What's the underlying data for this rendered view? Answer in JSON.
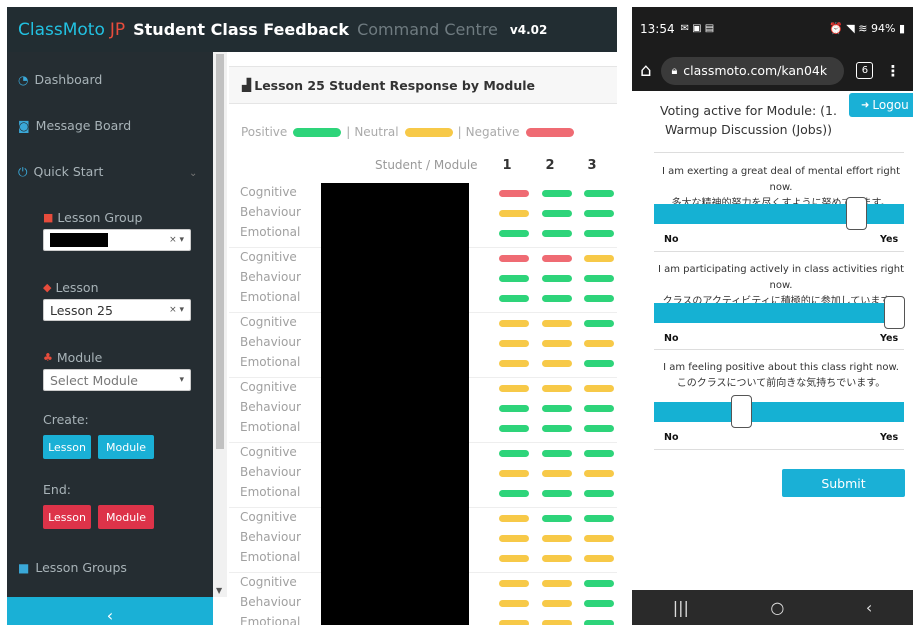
{
  "header": {
    "brand_main": "ClassMoto",
    "brand_suffix": "JP",
    "title": "Student Class Feedback",
    "subtitle": "Command Centre",
    "version": "v4.02"
  },
  "sidebar": {
    "dashboard": "Dashboard",
    "message_board": "Message Board",
    "quick_start": "Quick Start",
    "lesson_group_label": "Lesson Group",
    "lesson_label": "Lesson",
    "lesson_value": "Lesson 25",
    "module_label": "Module",
    "module_placeholder": "Select Module",
    "create_label": "Create:",
    "end_label": "End:",
    "btn_lesson": "Lesson",
    "btn_module": "Module",
    "lesson_groups": "Lesson Groups",
    "collapse_icon": "‹"
  },
  "panel": {
    "title": "Lesson 25 Student Response by Module",
    "legend": {
      "positive": "Positive",
      "neutral": "Neutral",
      "negative": "Negative",
      "sep": "|"
    },
    "column_header": "Student / Module",
    "modules": [
      "1",
      "2",
      "3"
    ],
    "categories": [
      "Cognitive",
      "Behaviour",
      "Emotional"
    ],
    "colors": {
      "positive": "#2ed47a",
      "neutral": "#f7c948",
      "negative": "#ef6b73"
    },
    "groups": [
      [
        [
          "neg",
          "pos",
          "pos"
        ],
        [
          "neu",
          "pos",
          "pos"
        ],
        [
          "pos",
          "pos",
          "pos"
        ]
      ],
      [
        [
          "neg",
          "neg",
          "neu"
        ],
        [
          "pos",
          "pos",
          "pos"
        ],
        [
          "pos",
          "pos",
          "pos"
        ]
      ],
      [
        [
          "neu",
          "neu",
          "pos"
        ],
        [
          "neu",
          "neu",
          "neu"
        ],
        [
          "neu",
          "neu",
          "pos"
        ]
      ],
      [
        [
          "neu",
          "neu",
          "neu"
        ],
        [
          "pos",
          "pos",
          "pos"
        ],
        [
          "pos",
          "pos",
          "pos"
        ]
      ],
      [
        [
          "pos",
          "pos",
          "pos"
        ],
        [
          "neu",
          "neu",
          "neu"
        ],
        [
          "pos",
          "pos",
          "pos"
        ]
      ],
      [
        [
          "neu",
          "pos",
          "pos"
        ],
        [
          "neu",
          "neu",
          "neu"
        ],
        [
          "neu",
          "neu",
          "neu"
        ]
      ],
      [
        [
          "neu",
          "neu",
          "pos"
        ],
        [
          "neu",
          "neu",
          "pos"
        ],
        [
          "neu",
          "neu",
          "pos"
        ]
      ]
    ]
  },
  "phone": {
    "status_time": "13:54",
    "status_right": "94%",
    "url": "classmoto.com/kan04k",
    "tab_count": "6",
    "voting_text": "Voting active for Module: (1. Warmup Discussion (Jobs))",
    "logout": "Logou",
    "questions": [
      {
        "en": "I am exerting a great deal of mental effort right now.",
        "jp": "多大な精神的努力を尽くすように努めています。",
        "value": 0.81
      },
      {
        "en": "I am participating actively in class activities right now.",
        "jp": "クラスのアクティビティに積極的に参加しています。",
        "value": 0.96
      },
      {
        "en": "I am feeling positive about this class right now.",
        "jp": "このクラスについて前向きな気持ちでいます。",
        "value": 0.35
      }
    ],
    "no_label": "No",
    "yes_label": "Yes",
    "submit": "Submit"
  }
}
